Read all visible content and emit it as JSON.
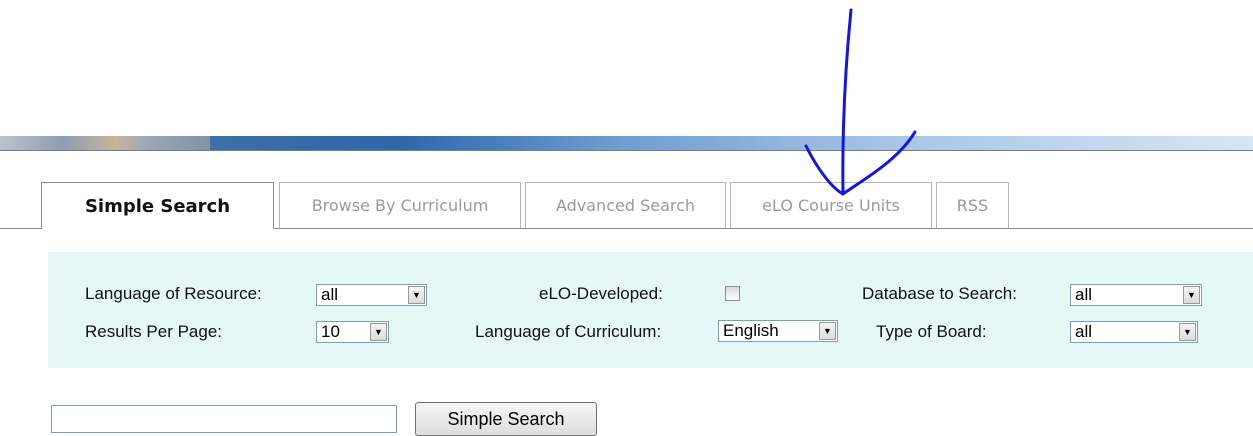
{
  "tabs": [
    {
      "label": "Simple Search",
      "active": true
    },
    {
      "label": "Browse By Curriculum",
      "active": false
    },
    {
      "label": "Advanced Search",
      "active": false
    },
    {
      "label": "eLO Course Units",
      "active": false
    },
    {
      "label": "RSS",
      "active": false
    }
  ],
  "options": {
    "language_of_resource": {
      "label": "Language of Resource:",
      "value": "all"
    },
    "results_per_page": {
      "label": "Results Per Page:",
      "value": "10"
    },
    "elo_developed": {
      "label": "eLO-Developed:",
      "checked": false
    },
    "language_of_curriculum": {
      "label": "Language of Curriculum:",
      "value": "English"
    },
    "database_to_search": {
      "label": "Database to Search:",
      "value": "all"
    },
    "type_of_board": {
      "label": "Type of Board:",
      "value": "all"
    }
  },
  "search": {
    "query": "",
    "button_label": "Simple Search"
  },
  "annotation": {
    "color": "#1414e6",
    "shape": "arrow-down-icon"
  }
}
